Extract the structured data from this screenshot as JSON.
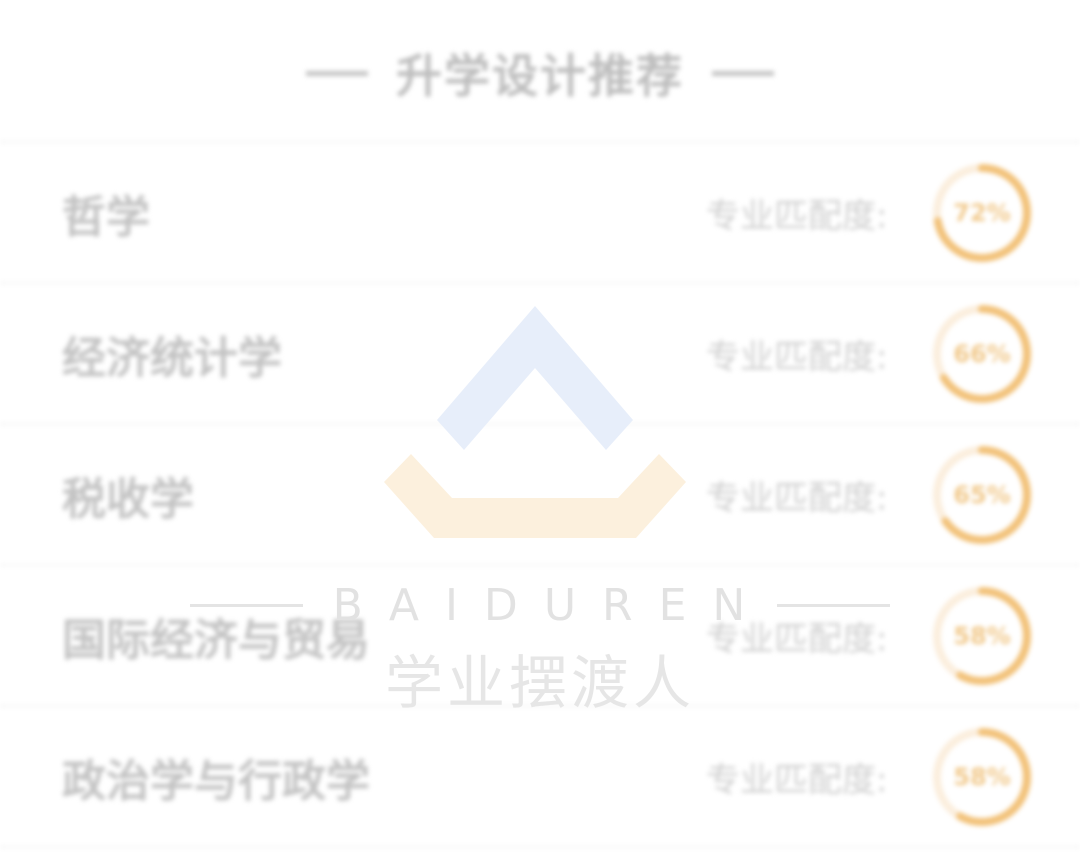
{
  "header": {
    "title": "升学设计推荐"
  },
  "list": {
    "items": [
      {
        "name": "哲学",
        "match_label": "专业匹配度:",
        "match_text": "72%",
        "match": 0.72
      },
      {
        "name": "经济统计学",
        "match_label": "专业匹配度:",
        "match_text": "66%",
        "match": 0.66
      },
      {
        "name": "税收学",
        "match_label": "专业匹配度:",
        "match_text": "65%",
        "match": 0.65
      },
      {
        "name": "国际经济与贸易",
        "match_label": "专业匹配度:",
        "match_text": "58%",
        "match": 0.58
      },
      {
        "name": "政治学与行政学",
        "match_label": "专业匹配度:",
        "match_text": "58%",
        "match": 0.58
      }
    ]
  },
  "watermark": {
    "latin": "BAIDUREN",
    "chinese": "学业摆渡人"
  },
  "colors": {
    "gauge_fill": "#f2c27a",
    "gauge_track": "#fbeedd",
    "logo_blue": "#e7eefa",
    "logo_orange": "#fcf0dd"
  }
}
